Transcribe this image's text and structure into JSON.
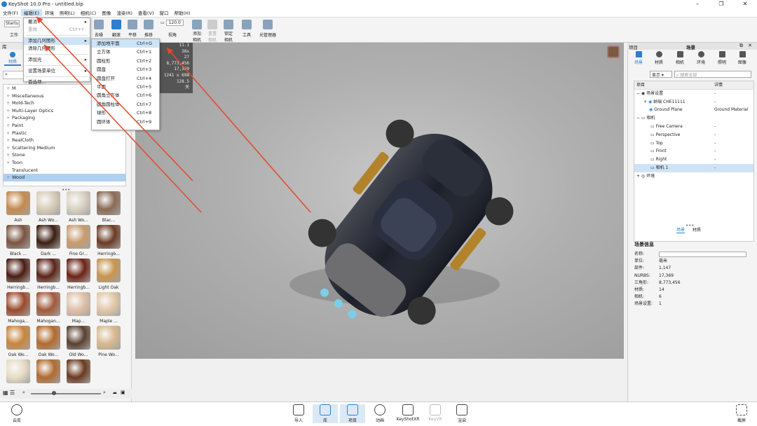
{
  "window": {
    "title": "KeyShot 10.0 Pro  - untitled.bip"
  },
  "menubar": [
    "文件(F)",
    "编辑(E)",
    "环境",
    "照明(L)",
    "相机(C)",
    "图像",
    "渲染(R)",
    "查看(V)",
    "窗口",
    "帮助(H)"
  ],
  "toolbar": {
    "workspace_input": "Startu",
    "workspace_label": "工作",
    "items": [
      {
        "label": "去噪"
      },
      {
        "label": "翻滚"
      },
      {
        "label": "平移"
      },
      {
        "label": "推移"
      },
      {
        "label": "视角",
        "value": "120.0"
      },
      {
        "label": "添加\n相机"
      },
      {
        "label": "重置\n相机"
      },
      {
        "label": "锁定\n相机"
      },
      {
        "label": "工具"
      },
      {
        "label": "光管理器"
      }
    ]
  },
  "edit_menu": {
    "items": [
      {
        "label": "撤消",
        "shortcut": "",
        "arrow": true,
        "disabled": false
      },
      {
        "label": "重做",
        "shortcut": "Ctrl+Y",
        "disabled": true
      },
      {
        "label": "添加几何图形",
        "shortcut": "",
        "arrow": true,
        "disabled": false,
        "highlight": true
      },
      {
        "label": "清除几何图形",
        "shortcut": "",
        "disabled": false
      },
      {
        "label": "添加光",
        "shortcut": "",
        "arrow": true,
        "disabled": false
      },
      {
        "label": "设置场景单位",
        "shortcut": "",
        "arrow": true,
        "disabled": false
      },
      {
        "label": "首选项...",
        "shortcut": "",
        "disabled": false
      }
    ]
  },
  "geometry_submenu": {
    "items": [
      {
        "label": "添加地平面",
        "shortcut": "Ctrl+G"
      },
      {
        "label": "立方体",
        "shortcut": "Ctrl+1"
      },
      {
        "label": "圆柱形",
        "shortcut": "Ctrl+2"
      },
      {
        "label": "圆盘",
        "shortcut": "Ctrl+3"
      },
      {
        "label": "圆盘打开",
        "shortcut": "Ctrl+4"
      },
      {
        "label": "平面",
        "shortcut": "Ctrl+5"
      },
      {
        "label": "圆角立方体",
        "shortcut": "Ctrl+6"
      },
      {
        "label": "圆角圆柱体",
        "shortcut": "Ctrl+7"
      },
      {
        "label": "球形",
        "shortcut": "Ctrl+8"
      },
      {
        "label": "圆环体",
        "shortcut": "Ctrl+9"
      }
    ]
  },
  "library": {
    "header": "库",
    "tab_label": "材质",
    "tree": [
      "Miscellaneous",
      "Mold-Tech",
      "Multi-Layer Optics",
      "Packaging",
      "Paint",
      "Plastic",
      "RealCloth",
      "Scattering Medium",
      "Stone",
      "Toon",
      "Translucent",
      "Wood"
    ],
    "tree_partial": "M",
    "selected": "Wood",
    "thumbnails": [
      {
        "label": "Ash",
        "color": "#c58a4d"
      },
      {
        "label": "Ash Wo...",
        "color": "#d8cdb8"
      },
      {
        "label": "Ash Wo...",
        "color": "#d9d2c3"
      },
      {
        "label": "Blac...",
        "color": "#8a6a55"
      },
      {
        "label": "Black ...",
        "color": "#7a5440"
      },
      {
        "label": "Dark ...",
        "color": "#3d1d12"
      },
      {
        "label": "Fine Gr...",
        "color": "#c89b6e"
      },
      {
        "label": "Herringb...",
        "color": "#6b3a24"
      },
      {
        "label": "Herringb...",
        "color": "#4a1c12"
      },
      {
        "label": "Herringb...",
        "color": "#5a2418"
      },
      {
        "label": "Herringb...",
        "color": "#6b2418"
      },
      {
        "label": "Light Oak",
        "color": "#c8954f"
      },
      {
        "label": "Mahoga...",
        "color": "#9a4a2a"
      },
      {
        "label": "Mahogan...",
        "color": "#a05a3a"
      },
      {
        "label": "Map...",
        "color": "#e0c0a8"
      },
      {
        "label": "Maple ...",
        "color": "#e2c8a8"
      },
      {
        "label": "Oak Wo...",
        "color": "#c9843c"
      },
      {
        "label": "Oak Wo...",
        "color": "#b26a2c"
      },
      {
        "label": "Old Wo...",
        "color": "#5a4030"
      },
      {
        "label": "Pine Wo...",
        "color": "#d9b98e"
      },
      {
        "label": "",
        "color": "#e8dcc4"
      },
      {
        "label": "",
        "color": "#b06a30"
      },
      {
        "label": "",
        "color": "#6a3a20"
      }
    ]
  },
  "stats": [
    "11.1",
    "38s",
    "27",
    "8,773,456",
    "17,369",
    "1241 x 698",
    "128.5",
    "关"
  ],
  "right_panel": {
    "header_left": "项目",
    "header": "场景",
    "tabs": [
      "场景",
      "材质",
      "相机",
      "环境",
      "照明",
      "图像"
    ],
    "filter": "显示",
    "search_placeholder": "搜索全部",
    "columns": [
      "项目",
      "详情"
    ],
    "rows": [
      {
        "name": "场景设置",
        "detail": "-",
        "indent": 0
      },
      {
        "name": "纳瑞 CHE11111",
        "detail": "-",
        "indent": 1
      },
      {
        "name": "Ground Plane",
        "detail": "Ground Material",
        "indent": 1
      },
      {
        "name": "相机",
        "detail": "",
        "indent": 0
      },
      {
        "name": "Free Camera",
        "detail": "-",
        "indent": 1
      },
      {
        "name": "Perspective",
        "detail": "-",
        "indent": 1
      },
      {
        "name": "Top",
        "detail": "-",
        "indent": 1
      },
      {
        "name": "Front",
        "detail": "-",
        "indent": 1
      },
      {
        "name": "Right",
        "detail": "-",
        "indent": 1
      },
      {
        "name": "相机 1",
        "detail": "-",
        "indent": 1
      },
      {
        "name": "环境",
        "detail": "",
        "indent": 0
      }
    ],
    "bottom_tabs": [
      "场景",
      "材质"
    ],
    "scene_info": {
      "title": "场景信息",
      "fields": [
        {
          "k": "名称:",
          "v": ""
        },
        {
          "k": "单位:",
          "v": "毫米"
        },
        {
          "k": "部件:",
          "v": "1,147"
        },
        {
          "k": "NURBS:",
          "v": "17,369"
        },
        {
          "k": "三角形:",
          "v": "8,773,456"
        },
        {
          "k": "材质:",
          "v": "14"
        },
        {
          "k": "相机:",
          "v": "6"
        },
        {
          "k": "场景设置:",
          "v": "1"
        }
      ]
    }
  },
  "bottombar": {
    "left": "云库",
    "items": [
      "导入",
      "库",
      "项目",
      "动画",
      "KeyShotXR",
      "KeyVR",
      "渲染"
    ],
    "right": "截屏"
  },
  "colors": {
    "accent": "#2a7fd4",
    "arrow": "#e24a2a"
  }
}
